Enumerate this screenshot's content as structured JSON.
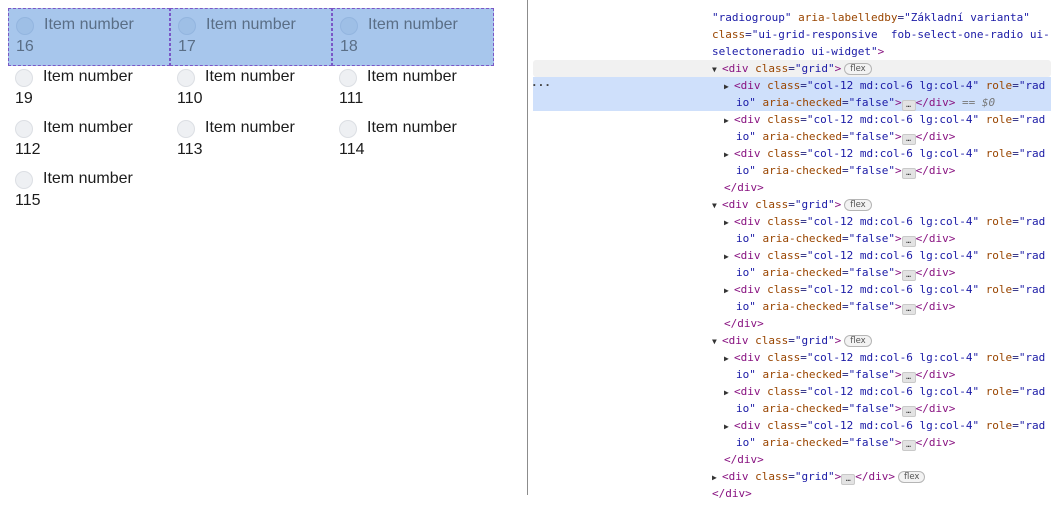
{
  "radio_group": {
    "item_label": "Item number",
    "rows": [
      [
        "16",
        "17",
        "18"
      ],
      [
        "19",
        "110",
        "111"
      ],
      [
        "112",
        "113",
        "114"
      ],
      [
        "115"
      ]
    ]
  },
  "devtools": {
    "header": {
      "l1_a": "\"radiogroup\"",
      "l1_b": "aria-labelledby",
      "l1_c": "\"Základní varianta\"",
      "l2_a": "class",
      "l2_b": "\"ui-grid-responsive  fob-select-one-radio ui-",
      "l3_a": "selectoneradio ui-widget\"",
      "l3_b": ">"
    },
    "grid_tag": "div",
    "grid_class_attr": "class",
    "grid_class_val": "\"grid\"",
    "flex_badge": "flex",
    "child_part1_attr_class": "class",
    "child_part1_val_class": "\"col-12 md:col-6 lg:col-4\"",
    "child_part1_attr_role": "role",
    "child_part1_val_role_a": "\"rad",
    "child_part2_val_role_b": "io\"",
    "child_part2_attr_aria": "aria-checked",
    "child_part2_val_aria": "\"false\"",
    "ellipsis": "…",
    "close_div": "</div>",
    "selected_suffix": "== $0",
    "row_dots": "···"
  }
}
